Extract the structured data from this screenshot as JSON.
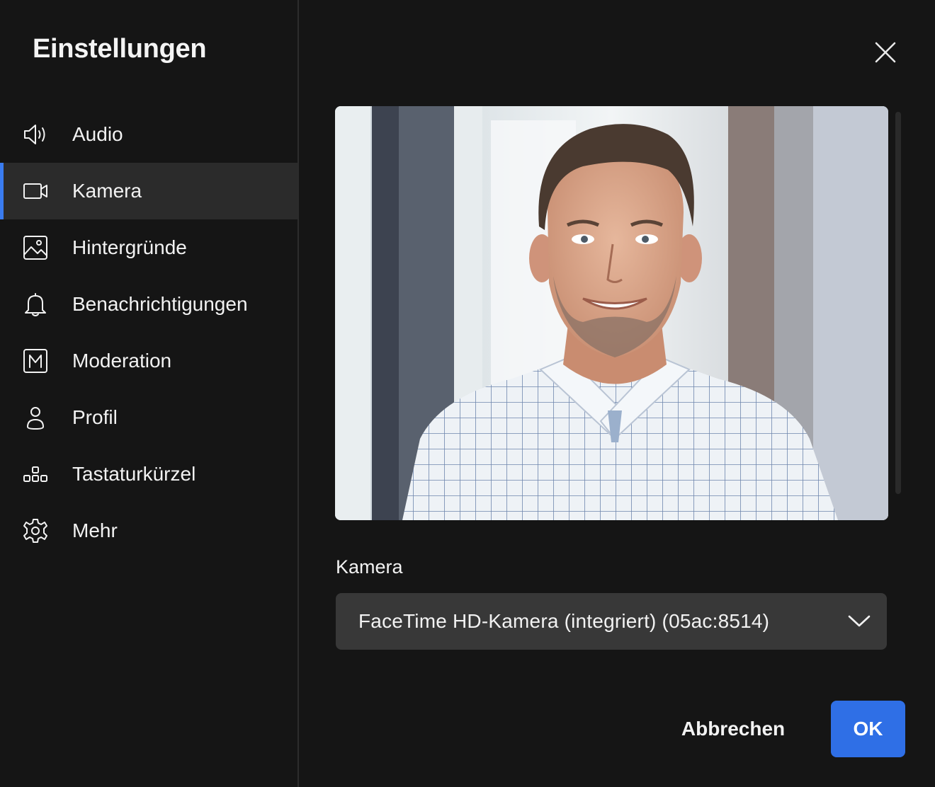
{
  "sidebar": {
    "title": "Einstellungen",
    "items": [
      {
        "label": "Audio",
        "icon": "speaker-icon",
        "active": false
      },
      {
        "label": "Kamera",
        "icon": "video-camera-icon",
        "active": true
      },
      {
        "label": "Hintergründe",
        "icon": "image-icon",
        "active": false
      },
      {
        "label": "Benachrichtigungen",
        "icon": "bell-icon",
        "active": false
      },
      {
        "label": "Moderation",
        "icon": "moderation-m-icon",
        "active": false
      },
      {
        "label": "Profil",
        "icon": "person-icon",
        "active": false
      },
      {
        "label": "Tastaturkürzel",
        "icon": "keyboard-shortcuts-icon",
        "active": false
      },
      {
        "label": "Mehr",
        "icon": "gear-icon",
        "active": false
      }
    ]
  },
  "main": {
    "close_icon": "close-icon",
    "camera_label": "Kamera",
    "camera_select": {
      "value": "FaceTime HD-Kamera (integriert) (05ac:8514)",
      "icon": "chevron-down-icon"
    },
    "buttons": {
      "cancel": "Abbrechen",
      "ok": "OK"
    }
  },
  "colors": {
    "background": "#151515",
    "sidebar_active": "#2b2b2b",
    "accent": "#3a7cf0",
    "ok_button": "#2f6fe6",
    "select_bg": "#383838"
  }
}
